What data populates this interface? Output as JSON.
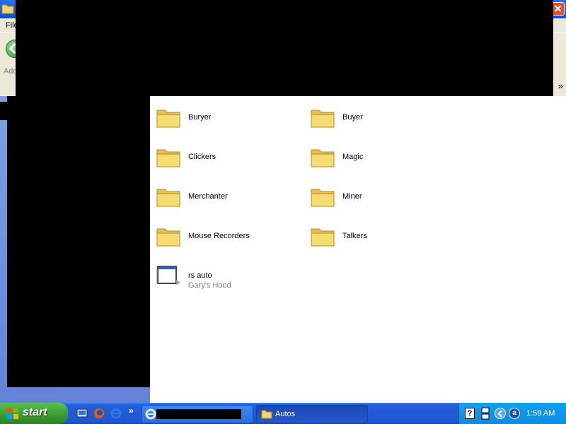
{
  "window": {
    "menu_file": "File",
    "address_label": "Address",
    "links_chevron": "»"
  },
  "content": {
    "items": [
      {
        "label": "Buryer",
        "type": "folder"
      },
      {
        "label": "Buyer",
        "type": "folder"
      },
      {
        "label": "Clickers",
        "type": "folder"
      },
      {
        "label": "Magic",
        "type": "folder"
      },
      {
        "label": "Merchanter",
        "type": "folder"
      },
      {
        "label": "Miner",
        "type": "folder"
      },
      {
        "label": "Mouse Recorders",
        "type": "folder"
      },
      {
        "label": "Talkers",
        "type": "folder"
      },
      {
        "label": "rs auto",
        "sublabel": "Gary's Hood",
        "type": "file"
      }
    ]
  },
  "taskbar": {
    "start_label": "start",
    "quicklaunch_chevron": "»",
    "tasks": [
      {
        "label": "",
        "icon": "internet-explorer-icon"
      },
      {
        "label": "Autos",
        "icon": "folder-icon"
      }
    ],
    "tray_help": "?",
    "tray_app": "a",
    "clock": "1:59 AM"
  },
  "colors": {
    "taskbar_blue": "#245edb",
    "start_green": "#3a9a2f",
    "folder_yellow": "#f5d566",
    "tray_blue": "#0c8be0"
  }
}
